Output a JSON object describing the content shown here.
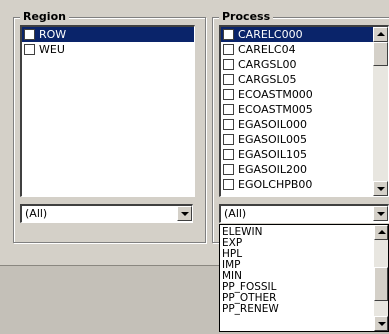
{
  "region": {
    "title": "Region",
    "items": [
      {
        "label": "ROW",
        "selected": true
      },
      {
        "label": "WEU",
        "selected": false
      }
    ],
    "filter": "(All)"
  },
  "process": {
    "title": "Process",
    "items": [
      {
        "label": "CARELC000",
        "selected": true
      },
      {
        "label": "CARELC04",
        "selected": false
      },
      {
        "label": "CARGSL00",
        "selected": false
      },
      {
        "label": "CARGSL05",
        "selected": false
      },
      {
        "label": "ECOASTM000",
        "selected": false
      },
      {
        "label": "ECOASTM005",
        "selected": false
      },
      {
        "label": "EGASOIL000",
        "selected": false
      },
      {
        "label": "EGASOIL005",
        "selected": false
      },
      {
        "label": "EGASOIL105",
        "selected": false
      },
      {
        "label": "EGASOIL200",
        "selected": false
      },
      {
        "label": "EGOLCHPB00",
        "selected": false
      }
    ],
    "filter": "(All)",
    "dropdown_options": [
      "ELEWIN",
      "EXP",
      "HPL",
      "IMP",
      "MIN",
      "PP_FOSSIL",
      "PP_OTHER",
      "PP_RENEW"
    ]
  }
}
